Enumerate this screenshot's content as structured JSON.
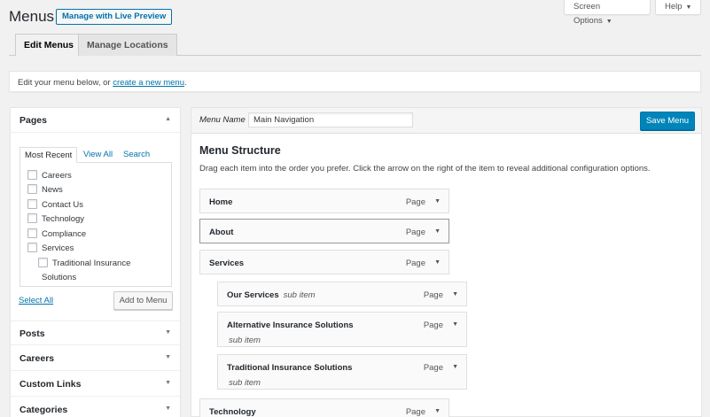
{
  "header": {
    "title": "Menus",
    "live_preview": "Manage with Live Preview",
    "screen_options": "Screen Options",
    "help": "Help",
    "dropdown_glyph": "▼"
  },
  "tabs": [
    {
      "label": "Edit Menus",
      "active": true
    },
    {
      "label": "Manage Locations",
      "active": false
    }
  ],
  "notice": {
    "prefix": "Edit your menu below, or ",
    "link": "create a new menu",
    "suffix": "."
  },
  "left": {
    "pages_title": "Pages",
    "inner_tabs": [
      "Most Recent",
      "View All",
      "Search"
    ],
    "pages": [
      "Careers",
      "News",
      "Contact Us",
      "Technology",
      "Compliance",
      "Services"
    ],
    "child_page": "Traditional Insurance",
    "child_page_wrap": "Solutions",
    "select_all": "Select All",
    "add_to_menu": "Add to Menu",
    "sections": [
      "Posts",
      "Careers",
      "Custom Links",
      "Categories"
    ],
    "arrow_up": "▲",
    "arrow_down": "▼"
  },
  "menu": {
    "name_label": "Menu Name",
    "name_value": "Main Navigation",
    "save": "Save Menu",
    "structure_title": "Menu Structure",
    "structure_desc": "Drag each item into the order you prefer. Click the arrow on the right of the item to reveal additional configuration options.",
    "type_label": "Page",
    "sub_item": "sub item",
    "items": [
      {
        "title": "Home"
      },
      {
        "title": "About"
      },
      {
        "title": "Services"
      },
      {
        "title": "Our Services"
      },
      {
        "title": "Alternative Insurance Solutions"
      },
      {
        "title": "Traditional Insurance Solutions"
      },
      {
        "title": "Technology"
      }
    ]
  },
  "colors": {
    "accent": "#0073aa",
    "primary_button": "#0085ba",
    "background": "#f1f1f1"
  }
}
